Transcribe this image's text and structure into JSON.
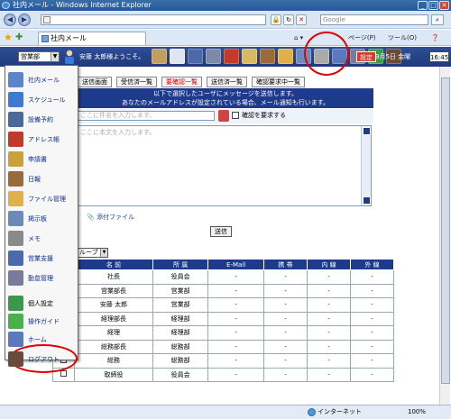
{
  "window": {
    "title": "社内メール - Windows Internet Explorer",
    "search_placeholder": "Google",
    "tab_title": "社内メール",
    "commands": {
      "page": "ページ(P)",
      "tools": "ツール(O)"
    }
  },
  "header": {
    "dept": "営業部",
    "welcome": "安藤 太郎様ようこそ。",
    "settings_label": "設定",
    "date": "9月5日 金曜",
    "clock": "16:45"
  },
  "tabs": [
    "送信画面",
    "受信済一覧",
    "要確認一覧",
    "送信済一覧",
    "確認要求中一覧"
  ],
  "message": {
    "head_line1": "以下で選択したユーザにメッセージを送信します。",
    "head_line2": "あなたのメールアドレスが設定されている場合、メール通知も行います。",
    "subject_placeholder": "ここに件名を入力します。",
    "confirm_label": "確認を要求する",
    "body_placeholder": "ここに本文を入力します。",
    "attach_label": "添付ファイル",
    "send_label": "送信"
  },
  "group_select": "ループ",
  "table": {
    "headers": [
      "名 前",
      "所 属",
      "E-Mail",
      "携 帯",
      "内 線",
      "外 線"
    ],
    "rows": [
      [
        "社長",
        "役員会",
        "-",
        "-",
        "-",
        "-"
      ],
      [
        "営業部長",
        "営業部",
        "-",
        "-",
        "-",
        "-"
      ],
      [
        "安藤 太郎",
        "営業部",
        "-",
        "-",
        "-",
        "-"
      ],
      [
        "経理部長",
        "経理部",
        "-",
        "-",
        "-",
        "-"
      ],
      [
        "経理",
        "経理部",
        "-",
        "-",
        "-",
        "-"
      ],
      [
        "総務部長",
        "総務部",
        "-",
        "-",
        "-",
        "-"
      ],
      [
        "総務",
        "総務部",
        "-",
        "-",
        "-",
        "-"
      ],
      [
        "取締役",
        "役員会",
        "-",
        "-",
        "-",
        "-"
      ]
    ]
  },
  "menu": [
    {
      "label": "社内メール",
      "color": "#5a86c9"
    },
    {
      "label": "スケジュール",
      "color": "#3e7bd0"
    },
    {
      "label": "設備予約",
      "color": "#4a6a9a"
    },
    {
      "label": "アドレス帳",
      "color": "#c03a2a"
    },
    {
      "label": "申請書",
      "color": "#c9a23a"
    },
    {
      "label": "日報",
      "color": "#9a6a3a"
    },
    {
      "label": "ファイル管理",
      "color": "#e0b04a"
    },
    {
      "label": "掲示板",
      "color": "#6a8aba"
    },
    {
      "label": "メモ",
      "color": "#8a8a8a"
    },
    {
      "label": "営業支援",
      "color": "#4a6ab0"
    },
    {
      "label": "勤怠管理",
      "color": "#7a7a9a"
    },
    {
      "label": "個人設定",
      "color": "#3a9a4a"
    },
    {
      "label": "操作ガイド",
      "color": "#4ab04a"
    },
    {
      "label": "ホーム",
      "color": "#5a7ac0"
    },
    {
      "label": "ログアウト",
      "color": "#6a4a3a"
    }
  ],
  "status": {
    "network": "インターネット",
    "zoom": "100%"
  }
}
